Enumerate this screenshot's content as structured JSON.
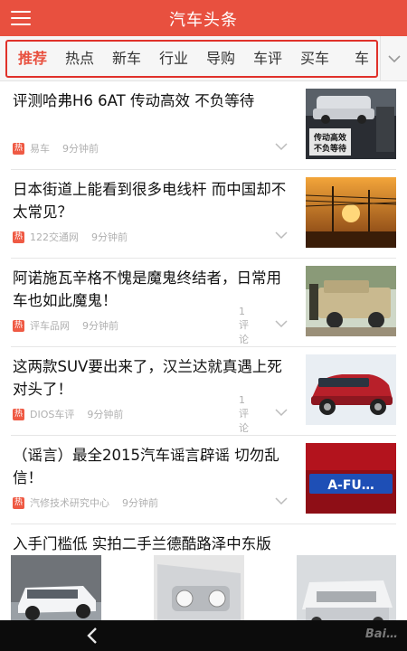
{
  "header": {
    "title": "汽车头条",
    "icon": "menu-icon"
  },
  "tabs": [
    "推荐",
    "热点",
    "新车",
    "行业",
    "导购",
    "车评",
    "买车",
    "车"
  ],
  "active_tab_index": 0,
  "articles": [
    {
      "title": "评测哈弗H6 6AT 传动高效 不负等待",
      "hot_label": "热",
      "source": "易车",
      "time": "9分钟前",
      "comments": "",
      "thumb_caption": "传动高效\n不负等待"
    },
    {
      "title": "日本街道上能看到很多电线杆 而中国却不太常见？",
      "hot_label": "热",
      "source": "122交通网",
      "time": "9分钟前",
      "comments": ""
    },
    {
      "title": "阿诺施瓦辛格不愧是魔鬼终结者，日常用车也如此魔鬼！",
      "hot_label": "热",
      "source": "评车品网",
      "time": "9分钟前",
      "comments": "1评论"
    },
    {
      "title": "这两款SUV要出来了，汉兰达就真遇上死对头了！",
      "hot_label": "热",
      "source": "DIOS车评",
      "time": "9分钟前",
      "comments": "1评论"
    },
    {
      "title": "（谣言）最全2015汽车谣言辟谣 切勿乱信！",
      "hot_label": "热",
      "source": "汽修技术研究中心",
      "time": "9分钟前",
      "comments": "",
      "thumb_caption": "A-FU…"
    },
    {
      "title": "入手门槛低 实拍二手兰德酷路泽中东版"
    }
  ],
  "nav": {
    "back_icon": "back-icon",
    "watermark": "Bai…"
  },
  "colors": {
    "brand": "#e8503f",
    "highlight": "#e0312a",
    "meta": "#b0b0b0"
  }
}
